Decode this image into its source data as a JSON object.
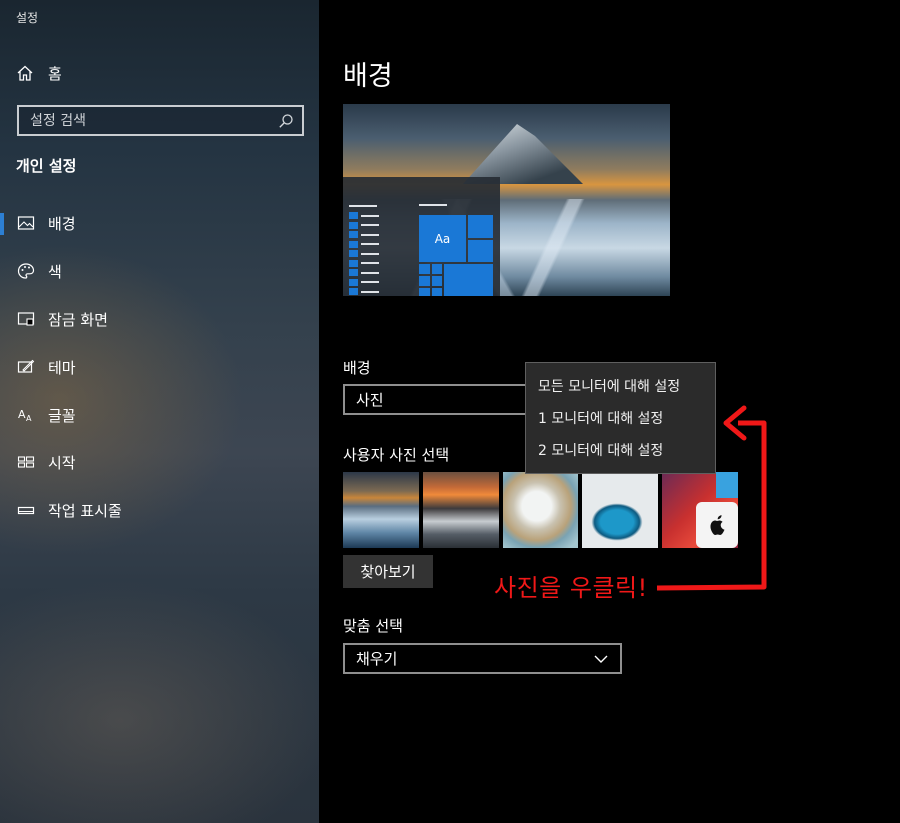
{
  "window": {
    "title": "설정"
  },
  "sidebar": {
    "home": "홈",
    "search_placeholder": "설정 검색",
    "section_title": "개인 설정",
    "items": [
      {
        "label": "배경",
        "icon": "image-icon",
        "active": true
      },
      {
        "label": "색",
        "icon": "palette-icon",
        "active": false
      },
      {
        "label": "잠금 화면",
        "icon": "lock-screen-icon",
        "active": false
      },
      {
        "label": "테마",
        "icon": "theme-icon",
        "active": false
      },
      {
        "label": "글꼴",
        "icon": "font-icon",
        "active": false
      },
      {
        "label": "시작",
        "icon": "start-icon",
        "active": false
      },
      {
        "label": "작업 표시줄",
        "icon": "taskbar-icon",
        "active": false
      }
    ]
  },
  "main": {
    "title": "배경",
    "preview_tile_text": "Aa",
    "background_label": "배경",
    "background_value": "사진",
    "choose_photo_label": "사용자 사진 선택",
    "browse_button": "찾아보기",
    "fit_label": "맞춤 선택",
    "fit_value": "채우기"
  },
  "context_menu": {
    "items": [
      "모든 모니터에 대해 설정",
      "1 모니터에 대해 설정",
      "2 모니터에 대해 설정"
    ]
  },
  "annotation": {
    "text": "사진을 우클릭!",
    "color": "#f01818"
  },
  "colors": {
    "accent": "#2d7fd3",
    "tile_blue": "#1a78d6"
  }
}
